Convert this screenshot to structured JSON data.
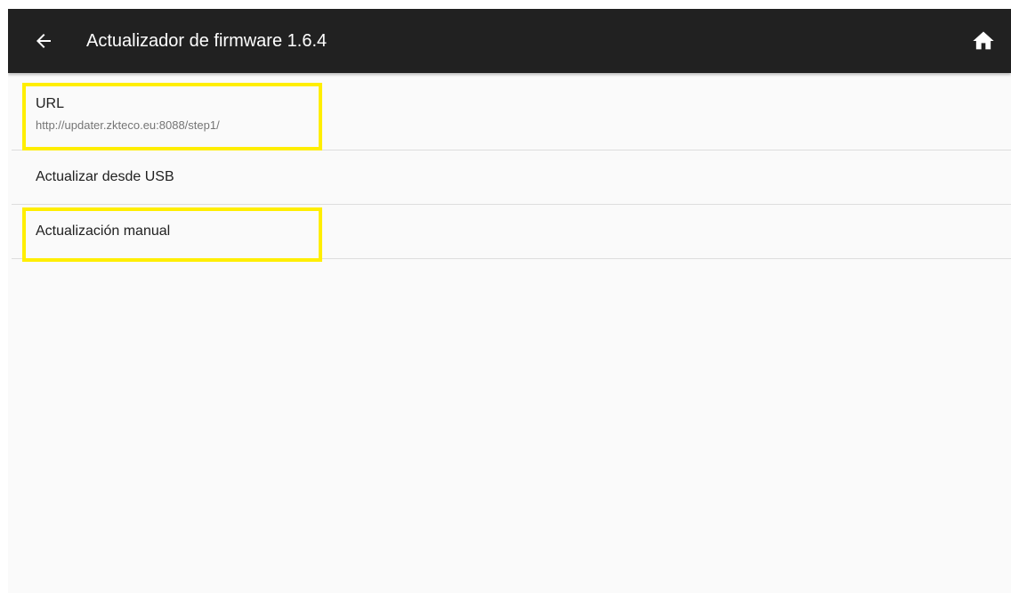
{
  "app_bar": {
    "title": "Actualizador de firmware 1.6.4",
    "back_icon": "arrow-back-icon",
    "home_icon": "home-icon",
    "background_color": "#212121",
    "text_color": "#ffffff"
  },
  "items": [
    {
      "title": "URL",
      "summary": "http://updater.zkteco.eu:8088/step1/",
      "highlighted": true
    },
    {
      "title": "Actualizar desde USB",
      "highlighted": false
    },
    {
      "title": "Actualización manual",
      "highlighted": true
    }
  ],
  "highlight_color": "#ffee00"
}
